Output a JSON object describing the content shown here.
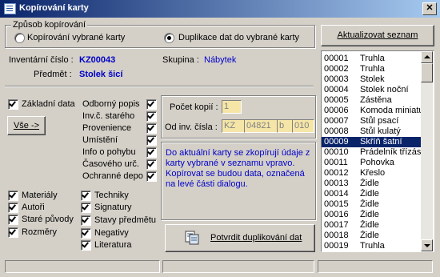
{
  "window": {
    "title": "Kopírování karty",
    "close_glyph": "✕"
  },
  "mode_group": {
    "legend": "Způsob kopírování",
    "options": [
      {
        "label": "Kopírování vybrané karty",
        "selected": false
      },
      {
        "label": "Duplikace dat do vybrané karty",
        "selected": true
      }
    ]
  },
  "refresh_button": "Aktualizovat seznam",
  "info": {
    "inventory_label": "Inventární číslo :",
    "inventory_value": "KZ00043",
    "group_label": "Skupina :",
    "group_value": "Nábytek",
    "subject_label": "Předmět :",
    "subject_value": "Stolek šicí"
  },
  "left_checks": [
    {
      "label": "Základní data",
      "checked": true
    }
  ],
  "all_button": "Vše ->",
  "middle_checks": [
    {
      "label": "Odborný popis",
      "checked": true
    },
    {
      "label": "Inv.č. starého",
      "checked": true
    },
    {
      "label": "Provenience",
      "checked": true
    },
    {
      "label": "Umístění",
      "checked": true
    },
    {
      "label": "Info o pohybu",
      "checked": true
    },
    {
      "label": "Časového urč.",
      "checked": true
    },
    {
      "label": "Ochranné depo",
      "checked": true
    }
  ],
  "bottom_left_checks": [
    {
      "label": "Materiály",
      "checked": true
    },
    {
      "label": "Autoři",
      "checked": true
    },
    {
      "label": "Staré původy",
      "checked": true
    },
    {
      "label": "Rozměry",
      "checked": true
    }
  ],
  "bottom_mid_checks": [
    {
      "label": "Techniky",
      "checked": true
    },
    {
      "label": "Signatury",
      "checked": true
    },
    {
      "label": "Stavy předmětu",
      "checked": true
    },
    {
      "label": "Negativy",
      "checked": true
    },
    {
      "label": "Literatura",
      "checked": true
    }
  ],
  "copies": {
    "count_label": "Počet kopií :",
    "count_value": "1",
    "from_label": "Od inv. čísla :",
    "prefix": "KZ",
    "number": "04821",
    "suffix": "b",
    "sub": "010"
  },
  "note": "Do aktuální karty se zkopírují údaje z karty vybrané v seznamu vpravo. Kopírovat se budou data, označená na levé části dialogu.",
  "confirm_button": "Potvrdit duplikování dat",
  "list": {
    "selected_index": 8,
    "items": [
      {
        "code": "00001",
        "name": "Truhla"
      },
      {
        "code": "00002",
        "name": "Truhla"
      },
      {
        "code": "00003",
        "name": "Stolek"
      },
      {
        "code": "00004",
        "name": "Stolek noční"
      },
      {
        "code": "00005",
        "name": "Zástěna"
      },
      {
        "code": "00006",
        "name": "Komoda miniatu"
      },
      {
        "code": "00007",
        "name": "Stůl psací"
      },
      {
        "code": "00008",
        "name": "Stůl kulatý"
      },
      {
        "code": "00009",
        "name": "Skříň šatní"
      },
      {
        "code": "00010",
        "name": "Prádelník třízás"
      },
      {
        "code": "00011",
        "name": "Pohovka"
      },
      {
        "code": "00012",
        "name": "Křeslo"
      },
      {
        "code": "00013",
        "name": "Židle"
      },
      {
        "code": "00014",
        "name": "Židle"
      },
      {
        "code": "00015",
        "name": "Židle"
      },
      {
        "code": "00016",
        "name": "Židle"
      },
      {
        "code": "00017",
        "name": "Židle"
      },
      {
        "code": "00018",
        "name": "Židle"
      },
      {
        "code": "00019",
        "name": "Truhla"
      }
    ]
  },
  "colors": {
    "title_start": "#0a246a",
    "title_end": "#a6caf0",
    "accent_text": "#0000c8",
    "readonly_field": "#f5e6a8",
    "selection": "#0a246a"
  }
}
